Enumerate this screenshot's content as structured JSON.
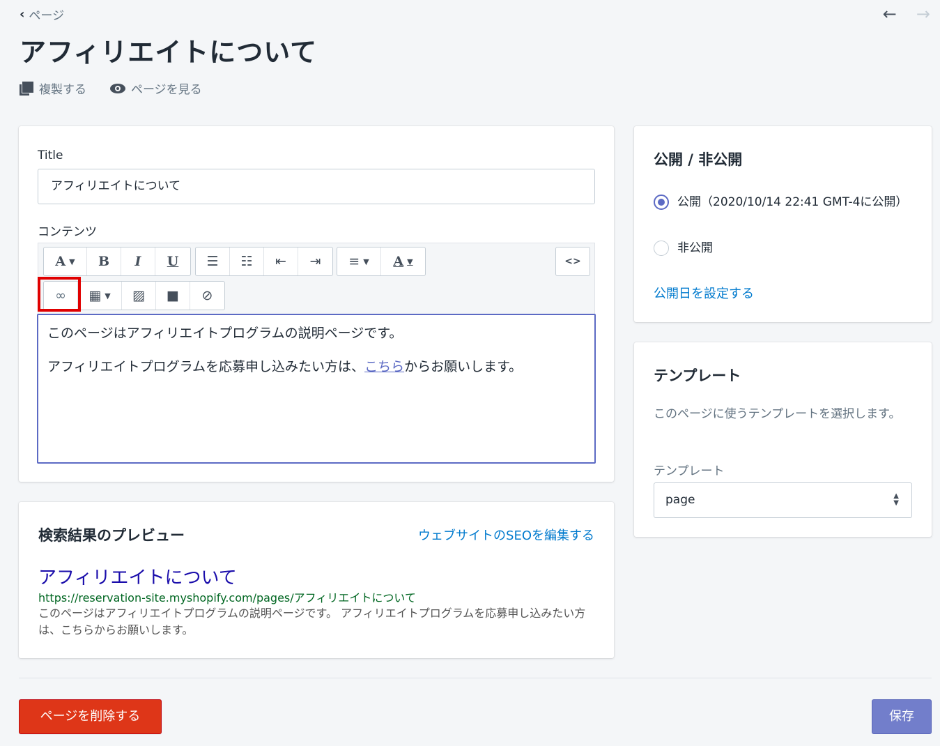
{
  "breadcrumb": {
    "label": "ページ"
  },
  "nav": {
    "prev": "←",
    "next": "→"
  },
  "page": {
    "title": "アフィリエイトについて"
  },
  "actions": {
    "duplicate": "複製する",
    "view": "ページを見る"
  },
  "form": {
    "title_label": "Title",
    "title_value": "アフィリエイトについて",
    "content_label": "コンテンツ"
  },
  "toolbar": {
    "font": "A",
    "bold": "B",
    "italic": "I",
    "underline": "U",
    "bullets": "☰",
    "numbered": "☷",
    "outdent": "⇤",
    "indent": "⇥",
    "align": "≡",
    "text_color": "A",
    "html": "<>",
    "link": "∞",
    "table": "▦",
    "image": "▨",
    "video": "■",
    "clear": "⊘"
  },
  "editor": {
    "paragraph1": "このページはアフィリエイトプログラムの説明ページです。",
    "paragraph2_before": "アフィリエイトプログラムを応募申し込みたい方は、",
    "paragraph2_link": "こちら",
    "paragraph2_after": "からお願いします。"
  },
  "seo": {
    "heading": "検索結果のプレビュー",
    "edit_link": "ウェブサイトのSEOを編集する",
    "title": "アフィリエイトについて",
    "url": "https://reservation-site.myshopify.com/pages/アフィリエイトについて",
    "description": "このページはアフィリエイトプログラムの説明ページです。 アフィリエイトプログラムを応募申し込みたい方は、こちらからお願いします。"
  },
  "visibility": {
    "heading": "公開 / 非公開",
    "published_label": "公開（2020/10/14 22:41 GMT-4に公開）",
    "hidden_label": "非公開",
    "selected": "published",
    "set_date_link": "公開日を設定する"
  },
  "template": {
    "heading": "テンプレート",
    "description": "このページに使うテンプレートを選択します。",
    "label": "テンプレート",
    "selected": "page"
  },
  "buttons": {
    "delete": "ページを削除する",
    "save": "保存"
  },
  "colors": {
    "accent": "#5c6ac4",
    "danger": "#de3618",
    "link": "#007ace",
    "highlight": "#e00000"
  }
}
